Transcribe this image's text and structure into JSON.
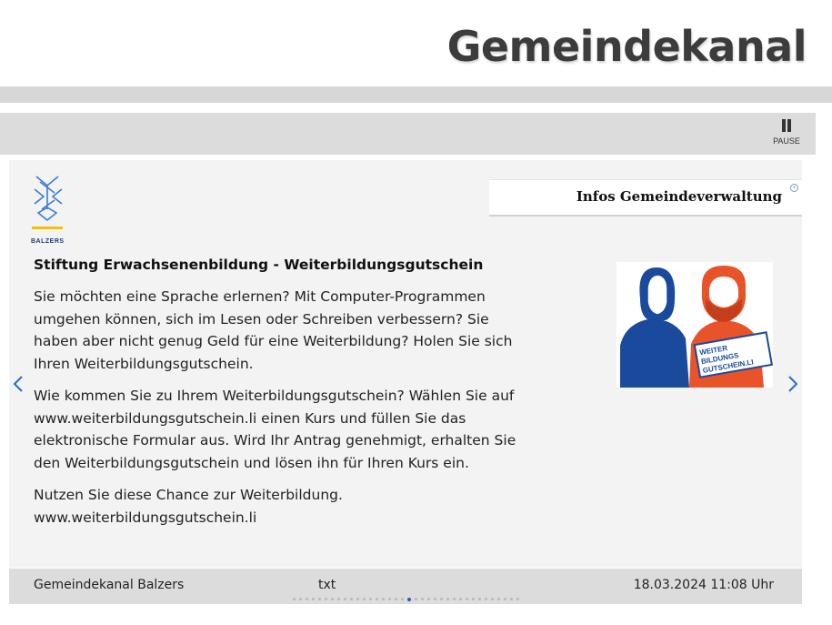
{
  "header": {
    "title": "Gemeindekanal"
  },
  "controls": {
    "pause_label": "PAUSE"
  },
  "category": {
    "label": "Infos Gemeindeverwaltung"
  },
  "logo": {
    "text": "BALZERS"
  },
  "article": {
    "title": "Stiftung Erwachsenenbildung - Weiterbildungsgutschein",
    "paragraphs": [
      "Sie möchten eine Sprache erlernen? Mit Computer-Programmen umgehen können, sich im Lesen oder Schreiben verbessern? Sie haben aber nicht genug Geld für eine Weiterbildung? Holen Sie sich Ihren Weiterbildungsgutschein.",
      "Wie kommen Sie zu Ihrem Weiterbildungsgutschein? Wählen Sie auf www.weiterbildungsgutschein.li einen Kurs und füllen Sie das elektronische Formular aus. Wird Ihr Antrag genehmigt, erhalten Sie den Weiterbildungsgutschein und lösen ihn für Ihren Kurs ein.",
      "Nutzen Sie diese Chance zur Weiterbildung. www.weiterbildungsgutschein.li"
    ]
  },
  "promo_image": {
    "line1": "WEITER",
    "line2": "BILDUNGS",
    "line3": "GUTSCHEIN.LI"
  },
  "footer": {
    "source": "Gemeindekanal Balzers",
    "type": "txt",
    "date": "18.03.2024 11:08 Uhr"
  },
  "pagination": {
    "total": 36,
    "active_index": 18
  },
  "colors": {
    "accent": "#2a5db0",
    "figure_blue": "#1a4a9c",
    "figure_orange": "#e8532a"
  }
}
